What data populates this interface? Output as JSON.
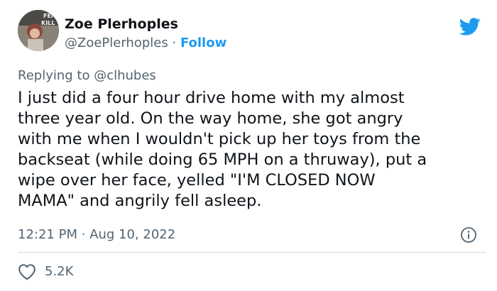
{
  "author": {
    "display_name": "Zoe Plerhoples",
    "handle": "@ZoePlerhoples",
    "separator": "·",
    "follow_label": "Follow",
    "avatar_text": "FEM KILL"
  },
  "reply": {
    "prefix": "Replying to",
    "mention": "@clhubes"
  },
  "tweet": {
    "lines": [
      "I just did a four hour drive home with my almost",
      "three year old. On the way home, she got angry",
      "with me when I wouldn't pick up her toys from the",
      "backseat (while doing 65 MPH on a thruway), put a",
      "wipe over her face, yelled \"I'M CLOSED NOW",
      "MAMA\" and angrily fell asleep."
    ]
  },
  "meta": {
    "time": "12:21 PM",
    "separator": "·",
    "date": "Aug 10, 2022"
  },
  "engagement": {
    "likes": "5.2K"
  },
  "colors": {
    "accent": "#1d9bf0",
    "secondary_text": "#536471",
    "divider": "#cfd9de"
  },
  "icons": [
    "twitter-bird-icon",
    "info-icon",
    "heart-icon"
  ]
}
